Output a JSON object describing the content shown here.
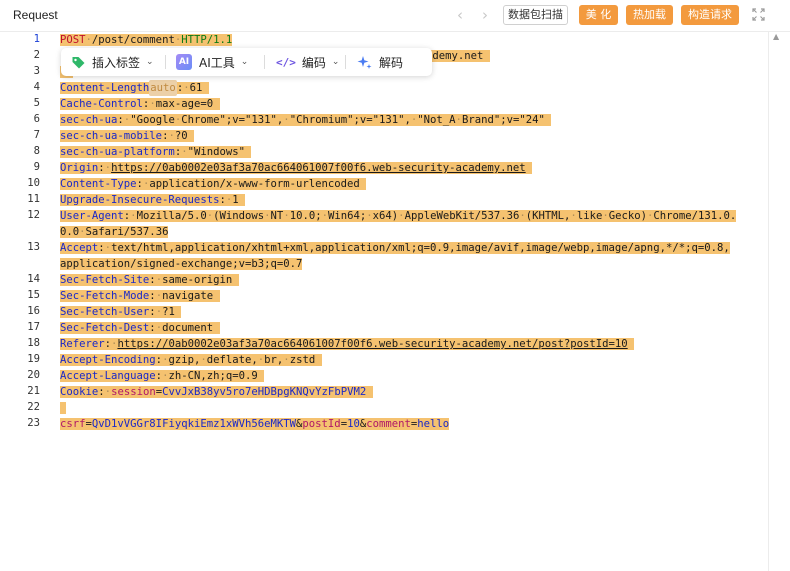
{
  "header": {
    "title": "Request",
    "scan_label": "数据包扫描",
    "beautify_label": "美 化",
    "hotload_label": "热加载",
    "construct_label": "构造请求"
  },
  "toolbar": {
    "insert_tag": "插入标签",
    "ai_tools": "AI工具",
    "ai_badge": "AI",
    "encode": "编码",
    "decode": "解码"
  },
  "colors": {
    "accent_orange": "#f39a3e",
    "highlight": "#f5c270",
    "header_key": "#1b28c8",
    "method": "#c0102a",
    "protocol": "#0a7a14",
    "cookie_key": "#b01868"
  },
  "editor": {
    "current_line": 1,
    "line_numbers": [
      "1",
      "2",
      "3",
      "4",
      "5",
      "6",
      "7",
      "8",
      "9",
      "10",
      "11",
      "12",
      "",
      "13",
      "",
      "14",
      "15",
      "16",
      "17",
      "18",
      "19",
      "20",
      "21",
      "22",
      "23"
    ],
    "request_line": {
      "method": "POST",
      "path": "/post/comment",
      "protocol": "HTTP/1.1"
    },
    "host_visible_tail": "ademy.net",
    "auto_chip": "auto",
    "headers": [
      {
        "key": "Content-Length",
        "value": "61"
      },
      {
        "key": "Cache-Control",
        "value": "max-age=0"
      },
      {
        "key": "sec-ch-ua",
        "value": "\"Google Chrome\";v=\"131\", \"Chromium\";v=\"131\", \"Not_A Brand\";v=\"24\""
      },
      {
        "key": "sec-ch-ua-mobile",
        "value": "?0"
      },
      {
        "key": "sec-ch-ua-platform",
        "value": "\"Windows\""
      },
      {
        "key": "Origin",
        "value": "https://0ab0002e03af3a70ac664061007f00f6.web-security-academy.net"
      },
      {
        "key": "Content-Type",
        "value": "application/x-www-form-urlencoded"
      },
      {
        "key": "Upgrade-Insecure-Requests",
        "value": "1"
      },
      {
        "key": "User-Agent",
        "value": "Mozilla/5.0 (Windows NT 10.0; Win64; x64) AppleWebKit/537.36 (KHTML, like Gecko) Chrome/131.0."
      },
      {
        "key": "User-Agent-cont",
        "value": "0.0 Safari/537.36"
      },
      {
        "key": "Accept",
        "value": "text/html,application/xhtml+xml,application/xml;q=0.9,image/avif,image/webp,image/apng,*/*;q=0.8,"
      },
      {
        "key": "Accept-cont",
        "value": "application/signed-exchange;v=b3;q=0.7"
      },
      {
        "key": "Sec-Fetch-Site",
        "value": "same-origin"
      },
      {
        "key": "Sec-Fetch-Mode",
        "value": "navigate"
      },
      {
        "key": "Sec-Fetch-User",
        "value": "?1"
      },
      {
        "key": "Sec-Fetch-Dest",
        "value": "document"
      },
      {
        "key": "Referer",
        "value": "https://0ab0002e03af3a70ac664061007f00f6.web-security-academy.net/post?postId=10"
      },
      {
        "key": "Accept-Encoding",
        "value": "gzip, deflate, br, zstd"
      },
      {
        "key": "Accept-Language",
        "value": "zh-CN,zh;q=0.9"
      }
    ],
    "cookie": {
      "key": "Cookie",
      "name": "session",
      "value": "CvvJxB38yv5ro7eHDBpgKNQvYzFbPVM2"
    },
    "body": [
      {
        "name": "csrf",
        "value": "QvD1vVGGr8IFiyqkiEmz1xWVh56eMKTW"
      },
      {
        "name": "postId",
        "value": "10"
      },
      {
        "name": "comment",
        "value": "hello"
      }
    ]
  }
}
